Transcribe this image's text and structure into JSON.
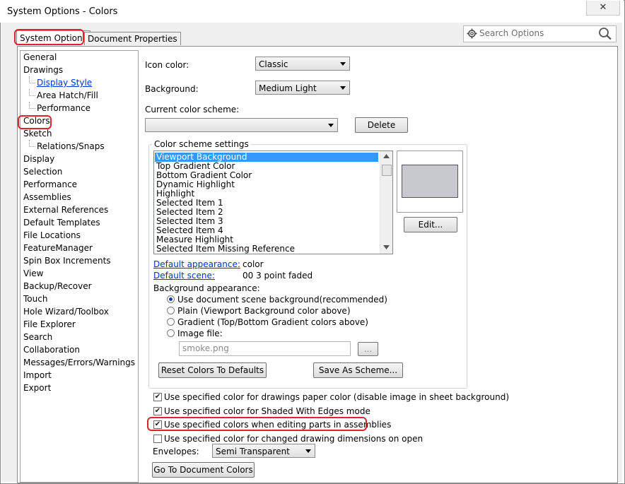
{
  "window": {
    "title": "System Options - Colors",
    "close_glyph": "✕"
  },
  "tabs": [
    {
      "label": "System Options"
    },
    {
      "label": "Document Properties"
    }
  ],
  "search": {
    "placeholder": "Search Options"
  },
  "tree": [
    {
      "label": "General",
      "level": 0
    },
    {
      "label": "Drawings",
      "level": 0
    },
    {
      "label": "Display Style",
      "level": 1,
      "link": true
    },
    {
      "label": "Area Hatch/Fill",
      "level": 1
    },
    {
      "label": "Performance",
      "level": 1
    },
    {
      "label": "Colors",
      "level": 0,
      "selected": true
    },
    {
      "label": "Sketch",
      "level": 0
    },
    {
      "label": "Relations/Snaps",
      "level": 1
    },
    {
      "label": "Display",
      "level": 0
    },
    {
      "label": "Selection",
      "level": 0
    },
    {
      "label": "Performance",
      "level": 0
    },
    {
      "label": "Assemblies",
      "level": 0
    },
    {
      "label": "External References",
      "level": 0
    },
    {
      "label": "Default Templates",
      "level": 0
    },
    {
      "label": "File Locations",
      "level": 0
    },
    {
      "label": "FeatureManager",
      "level": 0
    },
    {
      "label": "Spin Box Increments",
      "level": 0
    },
    {
      "label": "View",
      "level": 0
    },
    {
      "label": "Backup/Recover",
      "level": 0
    },
    {
      "label": "Touch",
      "level": 0
    },
    {
      "label": "Hole Wizard/Toolbox",
      "level": 0
    },
    {
      "label": "File Explorer",
      "level": 0
    },
    {
      "label": "Search",
      "level": 0
    },
    {
      "label": "Collaboration",
      "level": 0
    },
    {
      "label": "Messages/Errors/Warnings",
      "level": 0
    },
    {
      "label": "Import",
      "level": 0
    },
    {
      "label": "Export",
      "level": 0
    }
  ],
  "icon_color": {
    "label": "Icon color:",
    "value": "Classic"
  },
  "background": {
    "label": "Background:",
    "value": "Medium Light"
  },
  "scheme": {
    "label": "Current color scheme:",
    "value": "",
    "delete_label": "Delete"
  },
  "settings": {
    "group_title": "Color scheme settings",
    "items": [
      "Viewport Background",
      "Top Gradient Color",
      "Bottom Gradient Color",
      "Dynamic Highlight",
      "Highlight",
      "Selected Item 1",
      "Selected Item 2",
      "Selected Item 3",
      "Selected Item 4",
      "Measure Highlight",
      "Selected Item Missing Reference"
    ],
    "selected_index": 0,
    "swatch_color": "#c8c9cf",
    "edit_label": "Edit...",
    "default_appearance_label": "Default appearance:",
    "default_appearance_value": "color",
    "default_scene_label": "Default scene:",
    "default_scene_value": "00 3 point faded",
    "bg_appearance_label": "Background appearance:",
    "radios": [
      {
        "label": "Use document scene background(recommended)",
        "checked": true
      },
      {
        "label": "Plain (Viewport Background color above)",
        "checked": false
      },
      {
        "label": "Gradient (Top/Bottom Gradient colors above)",
        "checked": false
      },
      {
        "label": "Image file:",
        "checked": false
      }
    ],
    "image_file_value": "smoke.png",
    "browse_label": "...",
    "reset_label": "Reset Colors To Defaults",
    "save_label": "Save As Scheme..."
  },
  "checkboxes": [
    {
      "label": "Use specified color for drawings paper color (disable image in sheet background)",
      "checked": true
    },
    {
      "label": "Use specified color for Shaded With Edges mode",
      "checked": true
    },
    {
      "label": "Use specified colors when editing parts in assemblies",
      "checked": true
    },
    {
      "label": "Use specified color for changed drawing dimensions on open",
      "checked": false
    }
  ],
  "envelopes": {
    "label": "Envelopes:",
    "value": "Semi Transparent"
  },
  "goto_label": "Go To Document Colors",
  "colors": {
    "highlight_annotation": "#e0232b",
    "selection": "#3399ff",
    "link": "#0033cc"
  }
}
